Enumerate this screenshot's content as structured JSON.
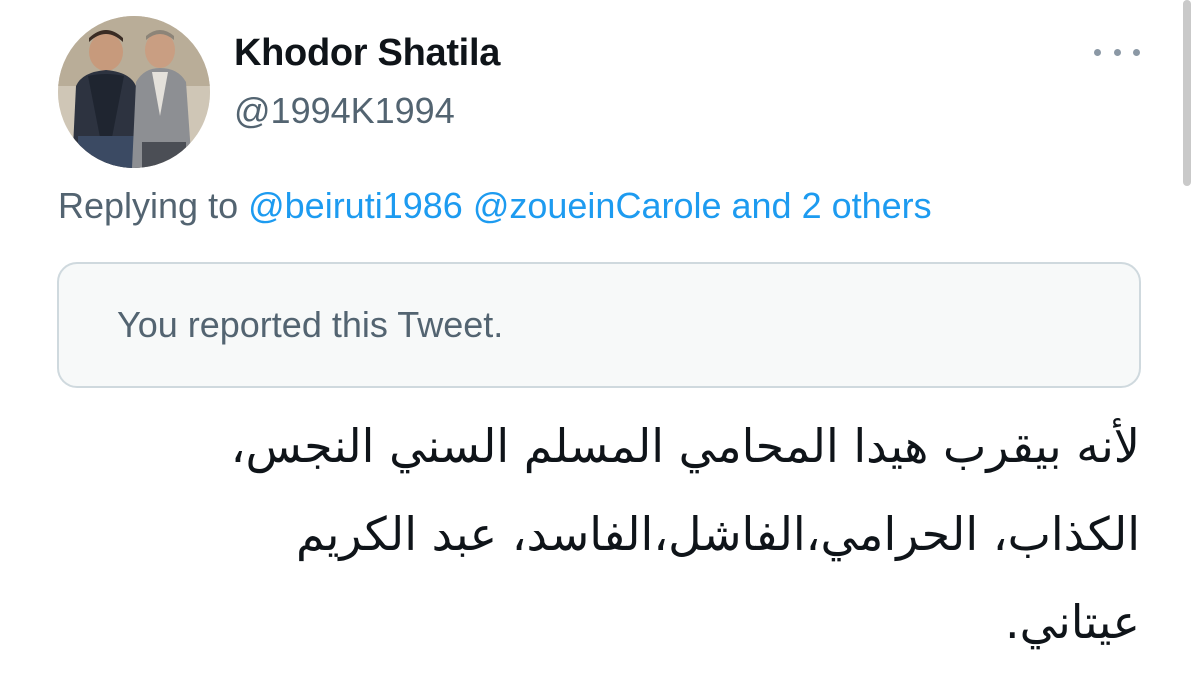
{
  "author": {
    "display_name": "Khodor Shatila",
    "handle": "@1994K1994",
    "avatar_icon": "profile-photo"
  },
  "reply": {
    "prefix": "Replying to ",
    "mention_1": "@beiruti1986",
    "mention_2": "@zoueinCarole",
    "others": "and 2 others"
  },
  "notice": {
    "text": "You reported this Tweet."
  },
  "tweet": {
    "line_1": "لأنه بيقرب هيدا المحامي المسلم السني النجس،",
    "line_2": "الكذاب، الحرامي،الفاشل،الفاسد، عبد الكريم",
    "line_3": "عيتاني."
  },
  "colors": {
    "link": "#1d9bf0",
    "secondary_text": "#536471",
    "notice_background": "#f7f9f9",
    "border": "#cfd9de"
  },
  "icons": {
    "more": "more-options-icon"
  }
}
